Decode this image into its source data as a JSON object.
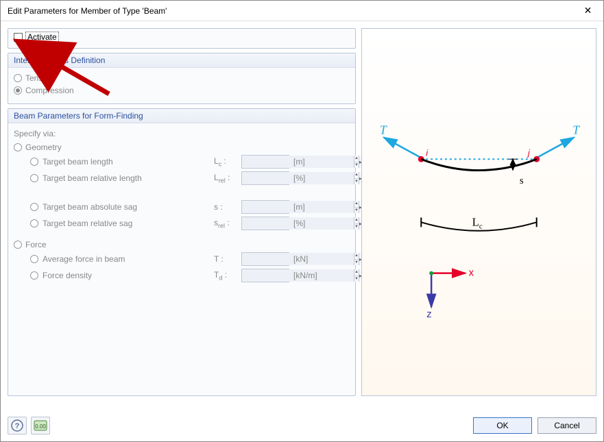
{
  "window": {
    "title": "Edit Parameters for Member of Type 'Beam'"
  },
  "activate": {
    "label": "Activate",
    "checked": false
  },
  "internal_forces": {
    "heading": "Internal Forces Definition",
    "opt_tension": "Tension",
    "opt_compression": "Compression"
  },
  "beam_params": {
    "heading": "Beam Parameters for Form-Finding",
    "specify_via": "Specify via:",
    "geometry": "Geometry",
    "force": "Force",
    "rows": {
      "target_length": {
        "label": "Target beam length",
        "var": "Lc :",
        "unit": "[m]"
      },
      "target_rel_length": {
        "label": "Target beam relative length",
        "var": "Lrel :",
        "unit": "[%]"
      },
      "target_abs_sag": {
        "label": "Target beam absolute sag",
        "var": "s :",
        "unit": "[m]"
      },
      "target_rel_sag": {
        "label": "Target beam relative sag",
        "var": "srel :",
        "unit": "[%]"
      },
      "avg_force": {
        "label": "Average force in beam",
        "var": "T :",
        "unit": "[kN]"
      },
      "force_density": {
        "label": "Force density",
        "var": "Td :",
        "unit": "[kN/m]"
      }
    }
  },
  "diagram": {
    "T_left": "T",
    "T_right": "T",
    "i": "i",
    "j": "j",
    "s": "s",
    "Lc": "Lc",
    "x": "x",
    "z": "z"
  },
  "buttons": {
    "ok": "OK",
    "cancel": "Cancel"
  }
}
